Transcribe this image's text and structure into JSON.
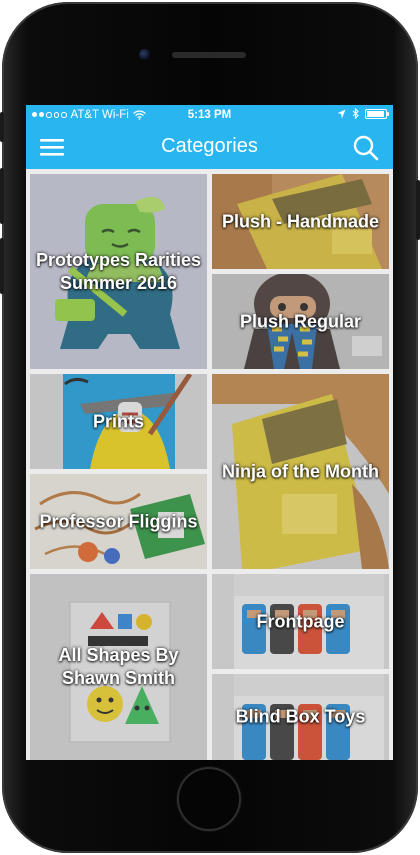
{
  "status_bar": {
    "carrier": "AT&T Wi-Fi",
    "time": "5:13 PM",
    "signal_bars": 2,
    "battery_level": 0.95
  },
  "nav": {
    "title": "Categories",
    "menu_icon": "hamburger-menu-icon",
    "search_icon": "search-icon"
  },
  "colors": {
    "accent": "#29b6f0",
    "text_on_accent": "#ffffff",
    "tile_text": "#ffffff"
  },
  "categories": [
    {
      "label": "Prototypes Rarities Summer 2016"
    },
    {
      "label": "Plush - Handmade"
    },
    {
      "label": "Plush Regular"
    },
    {
      "label": "Prints"
    },
    {
      "label": "Ninja of the Month"
    },
    {
      "label": "Professor Fliggins"
    },
    {
      "label": "All Shapes By Shawn Smith"
    },
    {
      "label": "Frontpage"
    },
    {
      "label": "Blind Box Toys"
    }
  ]
}
